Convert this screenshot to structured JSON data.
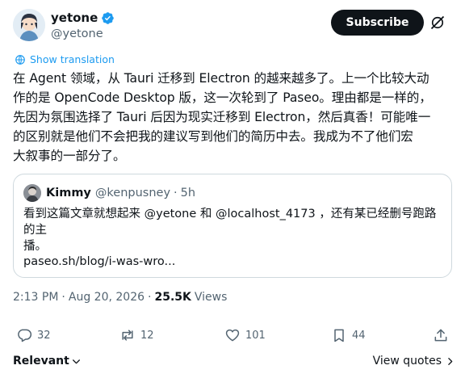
{
  "author": {
    "display_name": "yetone",
    "handle": "@yetone"
  },
  "subscribe_label": "Subscribe",
  "show_translation": "Show translation",
  "tweet": {
    "lines": [
      "在 Agent 领域，从 Tauri 迁移到 Electron 的越来越多了。上一个比较大动",
      "作的是 OpenCode Desktop 版，这一次轮到了 Paseo。理由都是一样的，",
      "先因为氛围选择了 Tauri 后因为现实迁移到 Electron，然后真香！可能唯一",
      "的区别就是他们不会把我的建议写到他们的简历中去。我成为不了他们宏",
      "大叙事的一部分了。"
    ]
  },
  "quote": {
    "display_name": "Kimmy",
    "handle": "@kenpusney",
    "dot": "·",
    "time": "5h",
    "text_lines": [
      "看到这篇文章就想起来 @yetone 和 @localhost_4173 ，还有某已经删号跑路的主",
      "播。"
    ],
    "link": "paseo.sh/blog/i-was-wro..."
  },
  "meta": {
    "time": "2:13 PM",
    "dot": "·",
    "date": "Aug 20, 2026",
    "views_count": "25.5K",
    "views_label": "Views"
  },
  "actions": {
    "replies": "32",
    "reposts": "12",
    "likes": "101",
    "bookmarks": "44"
  },
  "footer": {
    "relevant": "Relevant",
    "view_quotes": "View quotes"
  },
  "colors": {
    "accent": "#1d9bf0",
    "text": "#0f1419",
    "secondary": "#536471",
    "border": "#cfd9de"
  },
  "icons": [
    "verified-badge-icon",
    "grok-icon",
    "translate-globe-icon",
    "reply-icon",
    "repost-icon",
    "like-icon",
    "bookmark-icon",
    "share-icon",
    "chevron-down-icon",
    "chevron-right-icon"
  ]
}
